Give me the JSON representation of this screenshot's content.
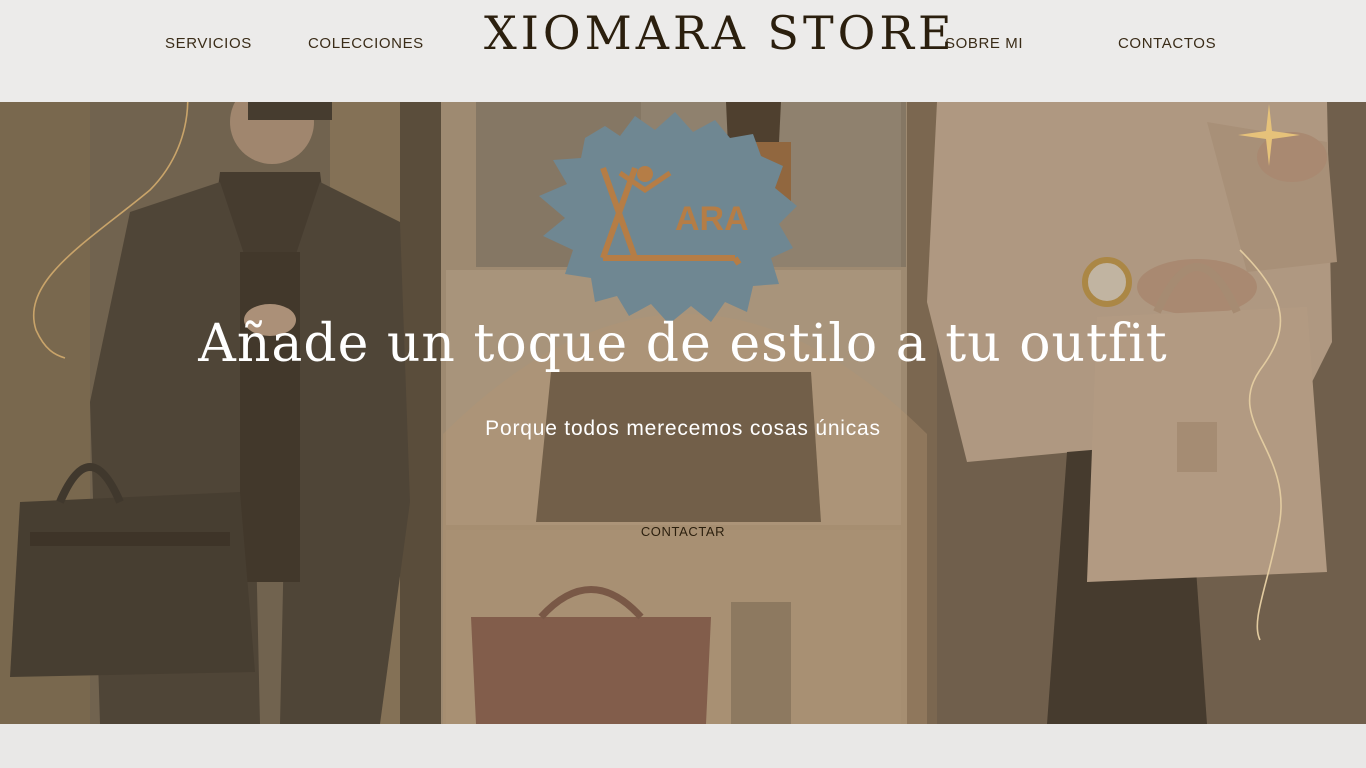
{
  "nav": {
    "brand": "XIOMARA STORE",
    "links": [
      "SERVICIOS",
      "COLECCIONES",
      "SOBRE MI",
      "CONTACTOS"
    ]
  },
  "hero": {
    "logo_text": "ARA",
    "headline": "Añade un toque de estilo a tu outfit",
    "subheadline": "Porque todos merecemos cosas únicas",
    "cta_label": "CONTACTAR"
  },
  "colors": {
    "nav_background": "#ecebea",
    "text_dark": "#2b1f0e",
    "gold_accent": "#c9a46a",
    "logo_blob": "#6f8792",
    "hero_overlay": "#786242"
  }
}
